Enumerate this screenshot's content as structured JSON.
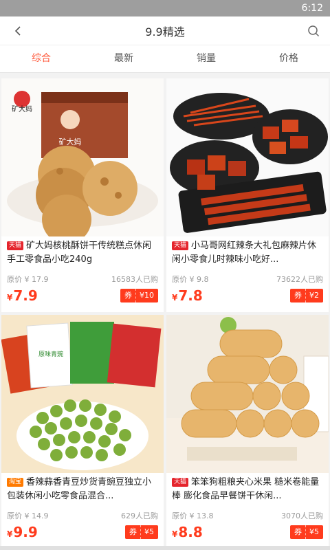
{
  "status": {
    "time": "6:12"
  },
  "header": {
    "title": "9.9精选",
    "back_icon": "back-chevron-icon",
    "search_icon": "search-icon"
  },
  "tabs": [
    {
      "label": "综合"
    },
    {
      "label": "最新"
    },
    {
      "label": "销量"
    },
    {
      "label": "价格"
    }
  ],
  "products": [
    {
      "badge": "天猫",
      "name": "矿大妈核桃酥饼干传统糕点休闲手工零食品小吃240g",
      "orig": "原价 ¥ 17.9",
      "sold": "16583人已购",
      "yen": "¥",
      "price": "7.9",
      "coupon_label": "券",
      "coupon_value": "¥10"
    },
    {
      "badge": "天猫",
      "name": "小马哥网红辣条大礼包麻辣片休闲小零食儿时辣味小吃好...",
      "orig": "原价 ¥ 9.8",
      "sold": "73622人已购",
      "yen": "¥",
      "price": "7.8",
      "coupon_label": "券",
      "coupon_value": "¥2"
    },
    {
      "badge": "淘宝",
      "name": "香辣蒜香青豆炒货青豌豆独立小包装休闲小吃零食品混合...",
      "orig": "原价 ¥ 14.9",
      "sold": "629人已购",
      "yen": "¥",
      "price": "9.9",
      "coupon_label": "券",
      "coupon_value": "¥5"
    },
    {
      "badge": "天猫",
      "name": "笨笨狗粗粮夹心米果 糙米卷能量棒 膨化食品早餐饼干休闲...",
      "orig": "原价 ¥ 13.8",
      "sold": "3070人已购",
      "yen": "¥",
      "price": "8.8",
      "coupon_label": "券",
      "coupon_value": "¥5"
    }
  ],
  "image_texts": {
    "brand": "矿大妈",
    "box": "矿大妈",
    "snack_bag": "原味青豌"
  }
}
